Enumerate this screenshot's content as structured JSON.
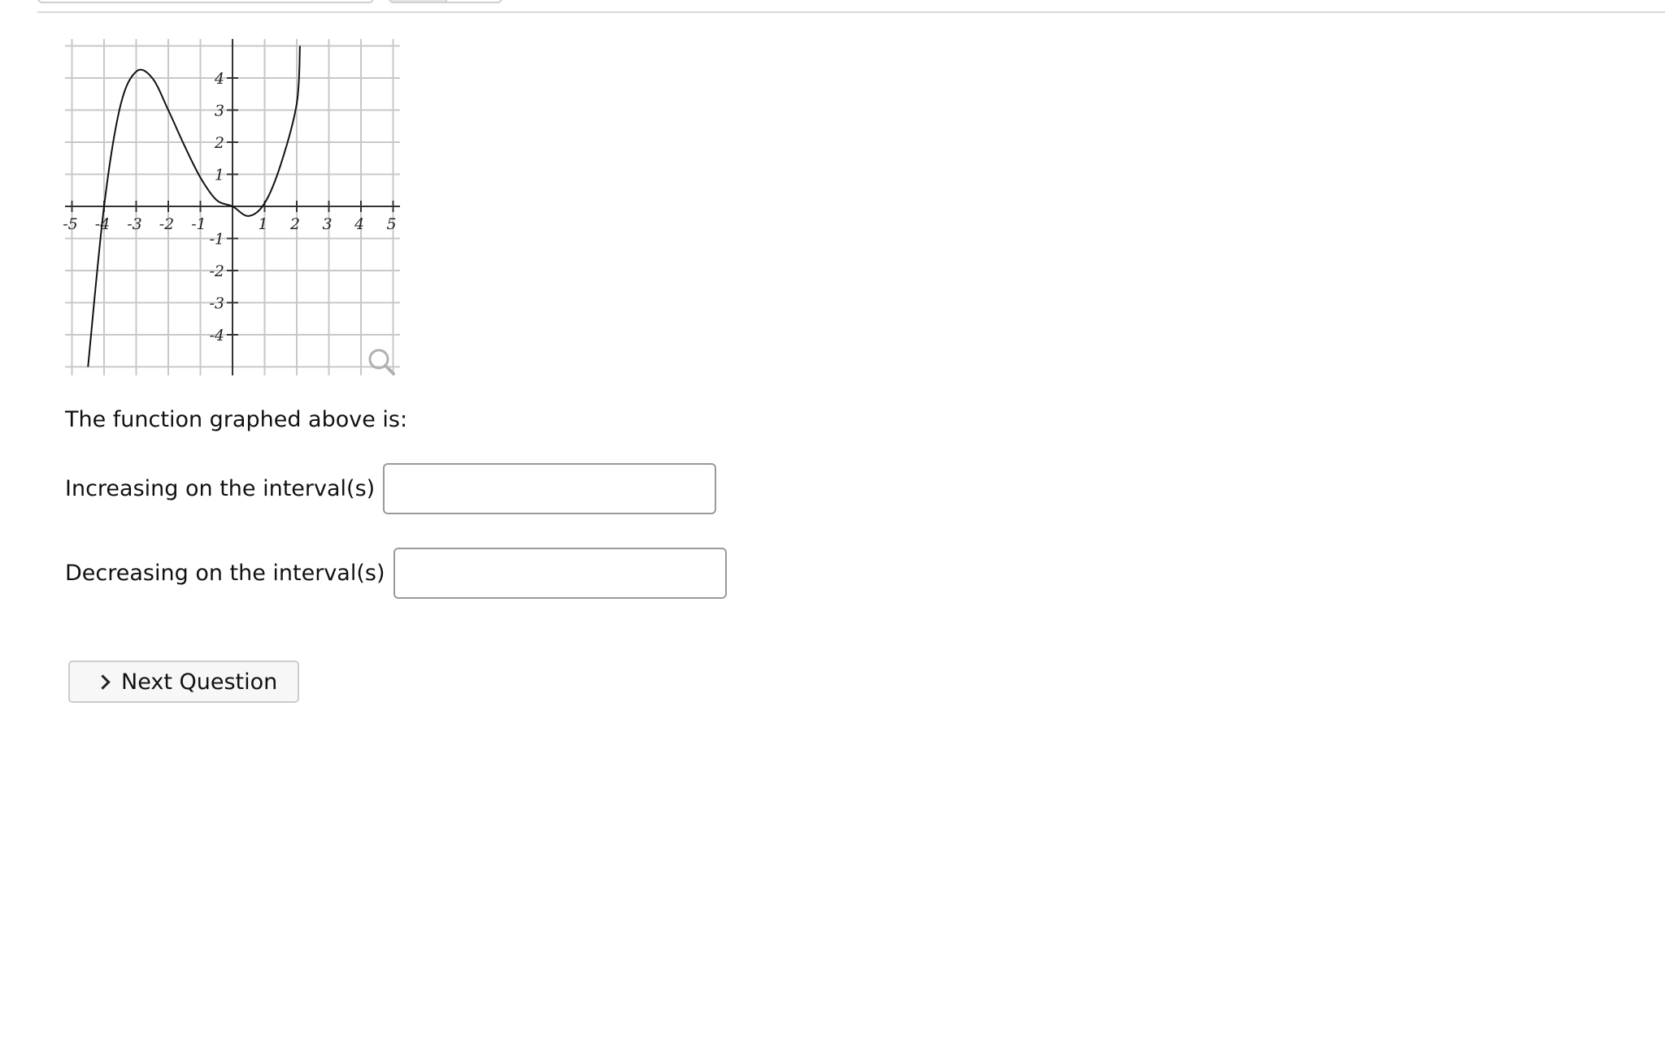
{
  "graph": {
    "x_tick_labels": [
      "-5",
      "-4",
      "-3",
      "-2",
      "-1",
      "1",
      "2",
      "3",
      "4",
      "5"
    ],
    "y_tick_labels": [
      "4",
      "3",
      "2",
      "1",
      "-1",
      "-2",
      "-3",
      "-4"
    ],
    "magnifier_icon": "magnifier-icon"
  },
  "chart_data": {
    "type": "line",
    "xlim": [
      -5,
      5
    ],
    "ylim": [
      -5,
      5
    ],
    "grid": true,
    "x_ticks": [
      -5,
      -4,
      -3,
      -2,
      -1,
      1,
      2,
      3,
      4,
      5
    ],
    "y_ticks": [
      -4,
      -3,
      -2,
      -1,
      1,
      2,
      3,
      4
    ],
    "series": [
      {
        "points": [
          [
            -4.5,
            -5.0
          ],
          [
            -4.0,
            0.0
          ],
          [
            -3.5,
            3.1
          ],
          [
            -3.0,
            4.2
          ],
          [
            -2.5,
            4.0
          ],
          [
            -2.0,
            3.0
          ],
          [
            -1.5,
            1.9
          ],
          [
            -1.0,
            0.9
          ],
          [
            -0.5,
            0.2
          ],
          [
            0.0,
            0.0
          ],
          [
            0.5,
            -0.3
          ],
          [
            1.0,
            0.1
          ],
          [
            1.5,
            1.3
          ],
          [
            2.0,
            3.2
          ],
          [
            2.1,
            5.0
          ]
        ]
      }
    ]
  },
  "question": {
    "prompt": "The function graphed above is:",
    "increasing_label": "Increasing on the interval(s)",
    "increasing_value": "",
    "decreasing_label": "Decreasing on the interval(s)",
    "decreasing_value": ""
  },
  "actions": {
    "next_label": "Next Question",
    "next_icon": "chevron-right-icon"
  }
}
